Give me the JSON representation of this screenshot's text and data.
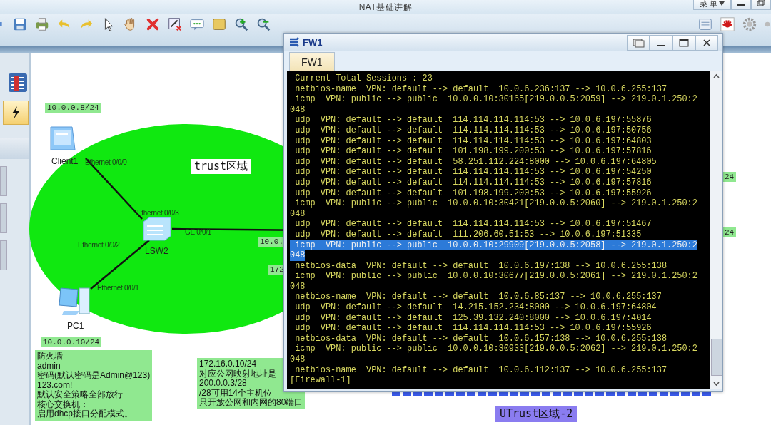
{
  "window": {
    "title": "NAT基础讲解",
    "menu_button": "菜 单"
  },
  "topology": {
    "zone_label": "trust区域",
    "zone2_label": "UTrust区域-2",
    "ip_labels": [
      "10.0.0.8/24",
      "10.0.0.10/24",
      "10.0.",
      "172",
      "24",
      "24"
    ],
    "devices": [
      {
        "kind": "client",
        "name": "Client1"
      },
      {
        "kind": "switch",
        "name": "LSW2"
      },
      {
        "kind": "pc",
        "name": "PC1"
      }
    ],
    "port_labels": [
      "Ethernet 0/0/0",
      "Ethernet 0/0/3",
      "GE 0/0/1",
      "Ethernet 0/0/2",
      "Ethernet 0/0/1"
    ],
    "notes": [
      {
        "lines": [
          "防火墙",
          "admin",
          "密码(默认密码是Admin@123)",
          "123.com!",
          "默认安全策略全部放行",
          "核心交换机：",
          "启用dhcp接口分配模式。"
        ]
      },
      {
        "lines": [
          "172.16.0.10/24",
          "对应公网映射地址是",
          "200.0.0.3/28",
          "/28可用14个主机位",
          "只开放公网和内网的80端口"
        ]
      }
    ]
  },
  "console": {
    "title": "FW1",
    "tabs": [
      {
        "label": "FW1",
        "selected": true
      }
    ],
    "lines": [
      {
        "text": " Current Total Sessions : 23",
        "selected": false
      },
      {
        "text": " netbios-name  VPN: default --> default  10.0.6.236:137 --> 10.0.6.255:137",
        "selected": false
      },
      {
        "text": " icmp  VPN: public --> public  10.0.0.10:30165[219.0.0.5:2059] --> 219.0.1.250:2",
        "selected": false
      },
      {
        "text": "048",
        "selected": false
      },
      {
        "text": " udp  VPN: default --> default  114.114.114.114:53 --> 10.0.6.197:55876",
        "selected": false
      },
      {
        "text": " udp  VPN: default --> default  114.114.114.114:53 --> 10.0.6.197:50756",
        "selected": false
      },
      {
        "text": " udp  VPN: default --> default  114.114.114.114:53 --> 10.0.6.197:64803",
        "selected": false
      },
      {
        "text": " udp  VPN: default --> default  101.198.199.200:53 --> 10.0.6.197:57816",
        "selected": false
      },
      {
        "text": " udp  VPN: default --> default  58.251.112.224:8000 --> 10.0.6.197:64805",
        "selected": false
      },
      {
        "text": " udp  VPN: default --> default  114.114.114.114:53 --> 10.0.6.197:54250",
        "selected": false
      },
      {
        "text": " udp  VPN: default --> default  114.114.114.114:53 --> 10.0.6.197:57816",
        "selected": false
      },
      {
        "text": " udp  VPN: default --> default  101.198.199.200:53 --> 10.0.6.197:55926",
        "selected": false
      },
      {
        "text": " icmp  VPN: public --> public  10.0.0.10:30421[219.0.0.5:2060] --> 219.0.1.250:2",
        "selected": false
      },
      {
        "text": "048",
        "selected": false
      },
      {
        "text": " udp  VPN: default --> default  114.114.114.114:53 --> 10.0.6.197:51467",
        "selected": false
      },
      {
        "text": " udp  VPN: default --> default  111.206.60.51:53 --> 10.0.6.197:51335",
        "selected": false
      },
      {
        "text": " icmp  VPN: public --> public  10.0.0.10:29909[219.0.0.5:2058] --> 219.0.1.250:2",
        "selected": true
      },
      {
        "text": "048",
        "selected": true
      },
      {
        "text": " netbios-data  VPN: default --> default  10.0.6.197:138 --> 10.0.6.255:138",
        "selected": false
      },
      {
        "text": " icmp  VPN: public --> public  10.0.0.10:30677[219.0.0.5:2061] --> 219.0.1.250:2",
        "selected": false
      },
      {
        "text": "048",
        "selected": false
      },
      {
        "text": " netbios-name  VPN: default --> default  10.0.6.85:137 --> 10.0.6.255:137",
        "selected": false
      },
      {
        "text": " udp  VPN: default --> default  14.215.152.234:8000 --> 10.0.6.197:64804",
        "selected": false
      },
      {
        "text": " udp  VPN: default --> default  125.39.132.240:8000 --> 10.0.6.197:4014",
        "selected": false
      },
      {
        "text": " udp  VPN: default --> default  114.114.114.114:53 --> 10.0.6.197:55926",
        "selected": false
      },
      {
        "text": " netbios-data  VPN: default --> default  10.0.6.157:138 --> 10.0.6.255:138",
        "selected": false
      },
      {
        "text": " icmp  VPN: public --> public  10.0.0.10:30933[219.0.0.5:2062] --> 219.0.1.250:2",
        "selected": false
      },
      {
        "text": "048",
        "selected": false
      },
      {
        "text": " netbios-name  VPN: default --> default  10.0.6.112:137 --> 10.0.6.255:137",
        "selected": false
      },
      {
        "text": "[Firewall-1]",
        "selected": false
      }
    ]
  }
}
